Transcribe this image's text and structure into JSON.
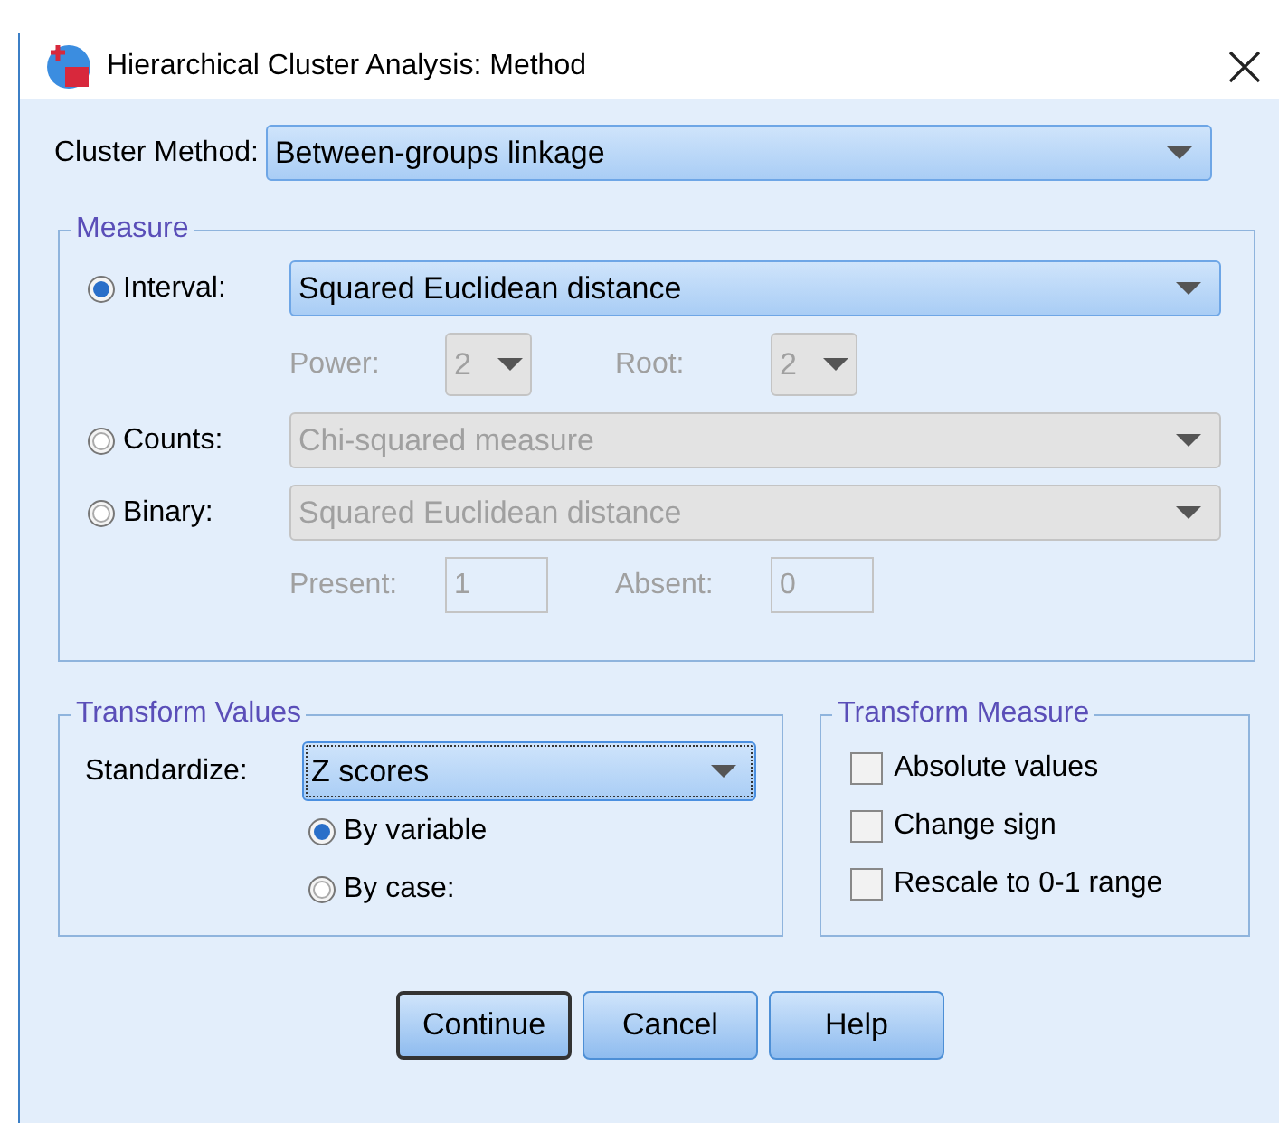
{
  "window": {
    "title": "Hierarchical Cluster Analysis: Method"
  },
  "cluster_method": {
    "label": "Cluster Method:",
    "value": "Between-groups linkage"
  },
  "measure": {
    "title": "Measure",
    "rows": [
      {
        "kind": "radio",
        "label": "Interval:",
        "selected": true,
        "value": "Squared Euclidean distance",
        "disabled": false
      },
      {
        "kind": "params",
        "items": [
          {
            "kind": "combo",
            "label": "Power:",
            "value": "2",
            "disabled": true
          },
          {
            "kind": "combo",
            "label": "Root:",
            "value": "2",
            "disabled": true
          }
        ]
      },
      {
        "kind": "radio",
        "label": "Counts:",
        "selected": false,
        "value": "Chi-squared measure",
        "disabled": true
      },
      {
        "kind": "radio",
        "label": "Binary:",
        "selected": false,
        "value": "Squared Euclidean distance",
        "disabled": true
      },
      {
        "kind": "params",
        "items": [
          {
            "kind": "text",
            "label": "Present:",
            "value": "1",
            "disabled": true
          },
          {
            "kind": "text",
            "label": "Absent:",
            "value": "0",
            "disabled": true
          }
        ]
      }
    ]
  },
  "transform_values": {
    "title": "Transform Values",
    "label": "Standardize:",
    "value": "Z scores",
    "options": [
      {
        "label": "By variable",
        "selected": true
      },
      {
        "label": "By case:",
        "selected": false
      }
    ]
  },
  "transform_measure": {
    "title": "Transform Measure",
    "options": [
      {
        "label": "Absolute values",
        "checked": false
      },
      {
        "label": "Change sign",
        "checked": false
      },
      {
        "label": "Rescale to 0-1 range",
        "checked": false
      }
    ]
  },
  "buttons": [
    {
      "label": "Continue",
      "default": true
    },
    {
      "label": "Cancel",
      "default": false
    },
    {
      "label": "Help",
      "default": false
    }
  ]
}
